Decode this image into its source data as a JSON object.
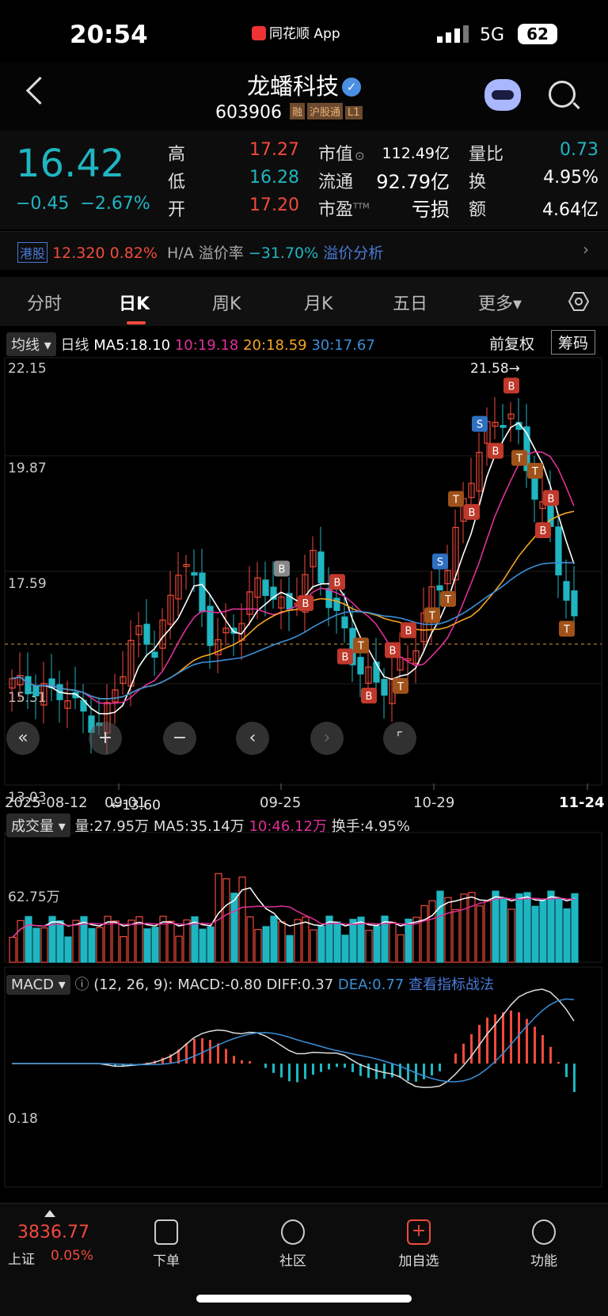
{
  "status_bar": {
    "time": "20:54",
    "app": "同花顺 App",
    "network": "5G",
    "battery": "62"
  },
  "header": {
    "name": "龙蟠科技",
    "code": "603906",
    "tags": [
      "融",
      "沪股通",
      "L1"
    ]
  },
  "quote": {
    "price": "16.42",
    "change": "−0.45",
    "change_pct": "−2.67%",
    "high_label": "高",
    "high": "17.27",
    "low_label": "低",
    "low": "16.28",
    "open_label": "开",
    "open": "17.20",
    "mcap_label": "市值",
    "mcap": "112.49亿",
    "float_label": "流通",
    "float": "92.79亿",
    "pe_label": "市盈",
    "pe_sup": "TTM",
    "pe": "亏损",
    "vr_label": "量比",
    "vr": "0.73",
    "turnover_label": "换",
    "turnover": "4.95%",
    "amount_label": "额",
    "amount": "4.64亿"
  },
  "hk_bar": {
    "badge": "港股",
    "price": "12.320",
    "pct": "0.82%",
    "premium_label": "H/A 溢价率",
    "premium": "−31.70%",
    "link": "溢价分析"
  },
  "tabs": [
    "分时",
    "日K",
    "周K",
    "月K",
    "五日",
    "更多▾"
  ],
  "ma_bar": {
    "dropdown": "均线",
    "period": "日线",
    "ma5": "MA5:18.10",
    "ma10": "10:19.18",
    "ma20": "20:18.59",
    "ma30": "30:17.67",
    "adjust": "前复权",
    "chips": "筹码"
  },
  "price_axis": [
    "22.15",
    "19.87",
    "17.59",
    "15.31",
    "13.03"
  ],
  "annotations": {
    "max": "21.58→",
    "min": "←13.60"
  },
  "date_axis": [
    "2025-08-12",
    "09-01",
    "09-25",
    "10-29",
    "11-24"
  ],
  "volume_bar": {
    "dropdown": "成交量",
    "vol": "量:27.95万",
    "ma5": "MA5:35.14万",
    "ma10": "10:46.12万",
    "turnover": "换手:4.95%",
    "axis": "62.75万"
  },
  "macd_bar": {
    "dropdown": "MACD",
    "params": "(12, 26, 9):",
    "macd": "MACD:-0.80",
    "diff": "DIFF:0.37",
    "dea": "DEA:0.77",
    "link": "查看指标战法",
    "axis": "0.18"
  },
  "footer": {
    "index_value": "3836.77",
    "index_name": "上证",
    "index_pct": "0.05%",
    "items": [
      "下单",
      "社区",
      "加自选",
      "功能"
    ]
  },
  "colors": {
    "up": "#f14a3c",
    "down": "#1fb6c2",
    "ma5": "#ffffff",
    "ma10": "#e0309a",
    "ma20": "#f5a623",
    "ma30": "#3a8fd8"
  }
}
